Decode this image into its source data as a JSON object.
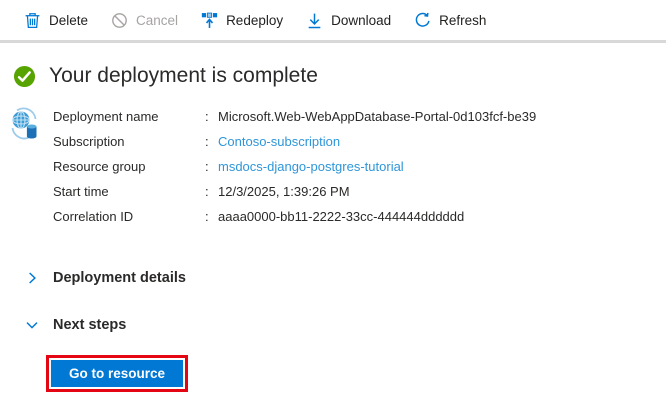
{
  "toolbar": {
    "delete": {
      "label": "Delete"
    },
    "cancel": {
      "label": "Cancel"
    },
    "redeploy": {
      "label": "Redeploy"
    },
    "download": {
      "label": "Download"
    },
    "refresh": {
      "label": "Refresh"
    }
  },
  "status": {
    "title": "Your deployment is complete"
  },
  "deployment": {
    "separator": ":",
    "fields": [
      {
        "label": "Deployment name",
        "value": "Microsoft.Web-WebAppDatabase-Portal-0d103fcf-be39"
      },
      {
        "label": "Subscription",
        "value": "Contoso-subscription"
      },
      {
        "label": "Resource group",
        "value": "msdocs-django-postgres-tutorial"
      },
      {
        "label": "Start time",
        "value": "12/3/2025, 1:39:26 PM"
      },
      {
        "label": "Correlation ID",
        "value": "aaaa0000-bb11-2222-33cc-444444dddddd"
      }
    ]
  },
  "sections": {
    "deployment_details": {
      "label": "Deployment details",
      "expanded": false
    },
    "next_steps": {
      "label": "Next steps",
      "expanded": true
    }
  },
  "actions": {
    "go_to_resource": "Go to resource"
  },
  "colors": {
    "accent_blue": "#0078d4",
    "link_blue": "#2e96d9",
    "success_green": "#57a300",
    "disabled_gray": "#a6a4a2",
    "highlight_red": "#e40613"
  }
}
